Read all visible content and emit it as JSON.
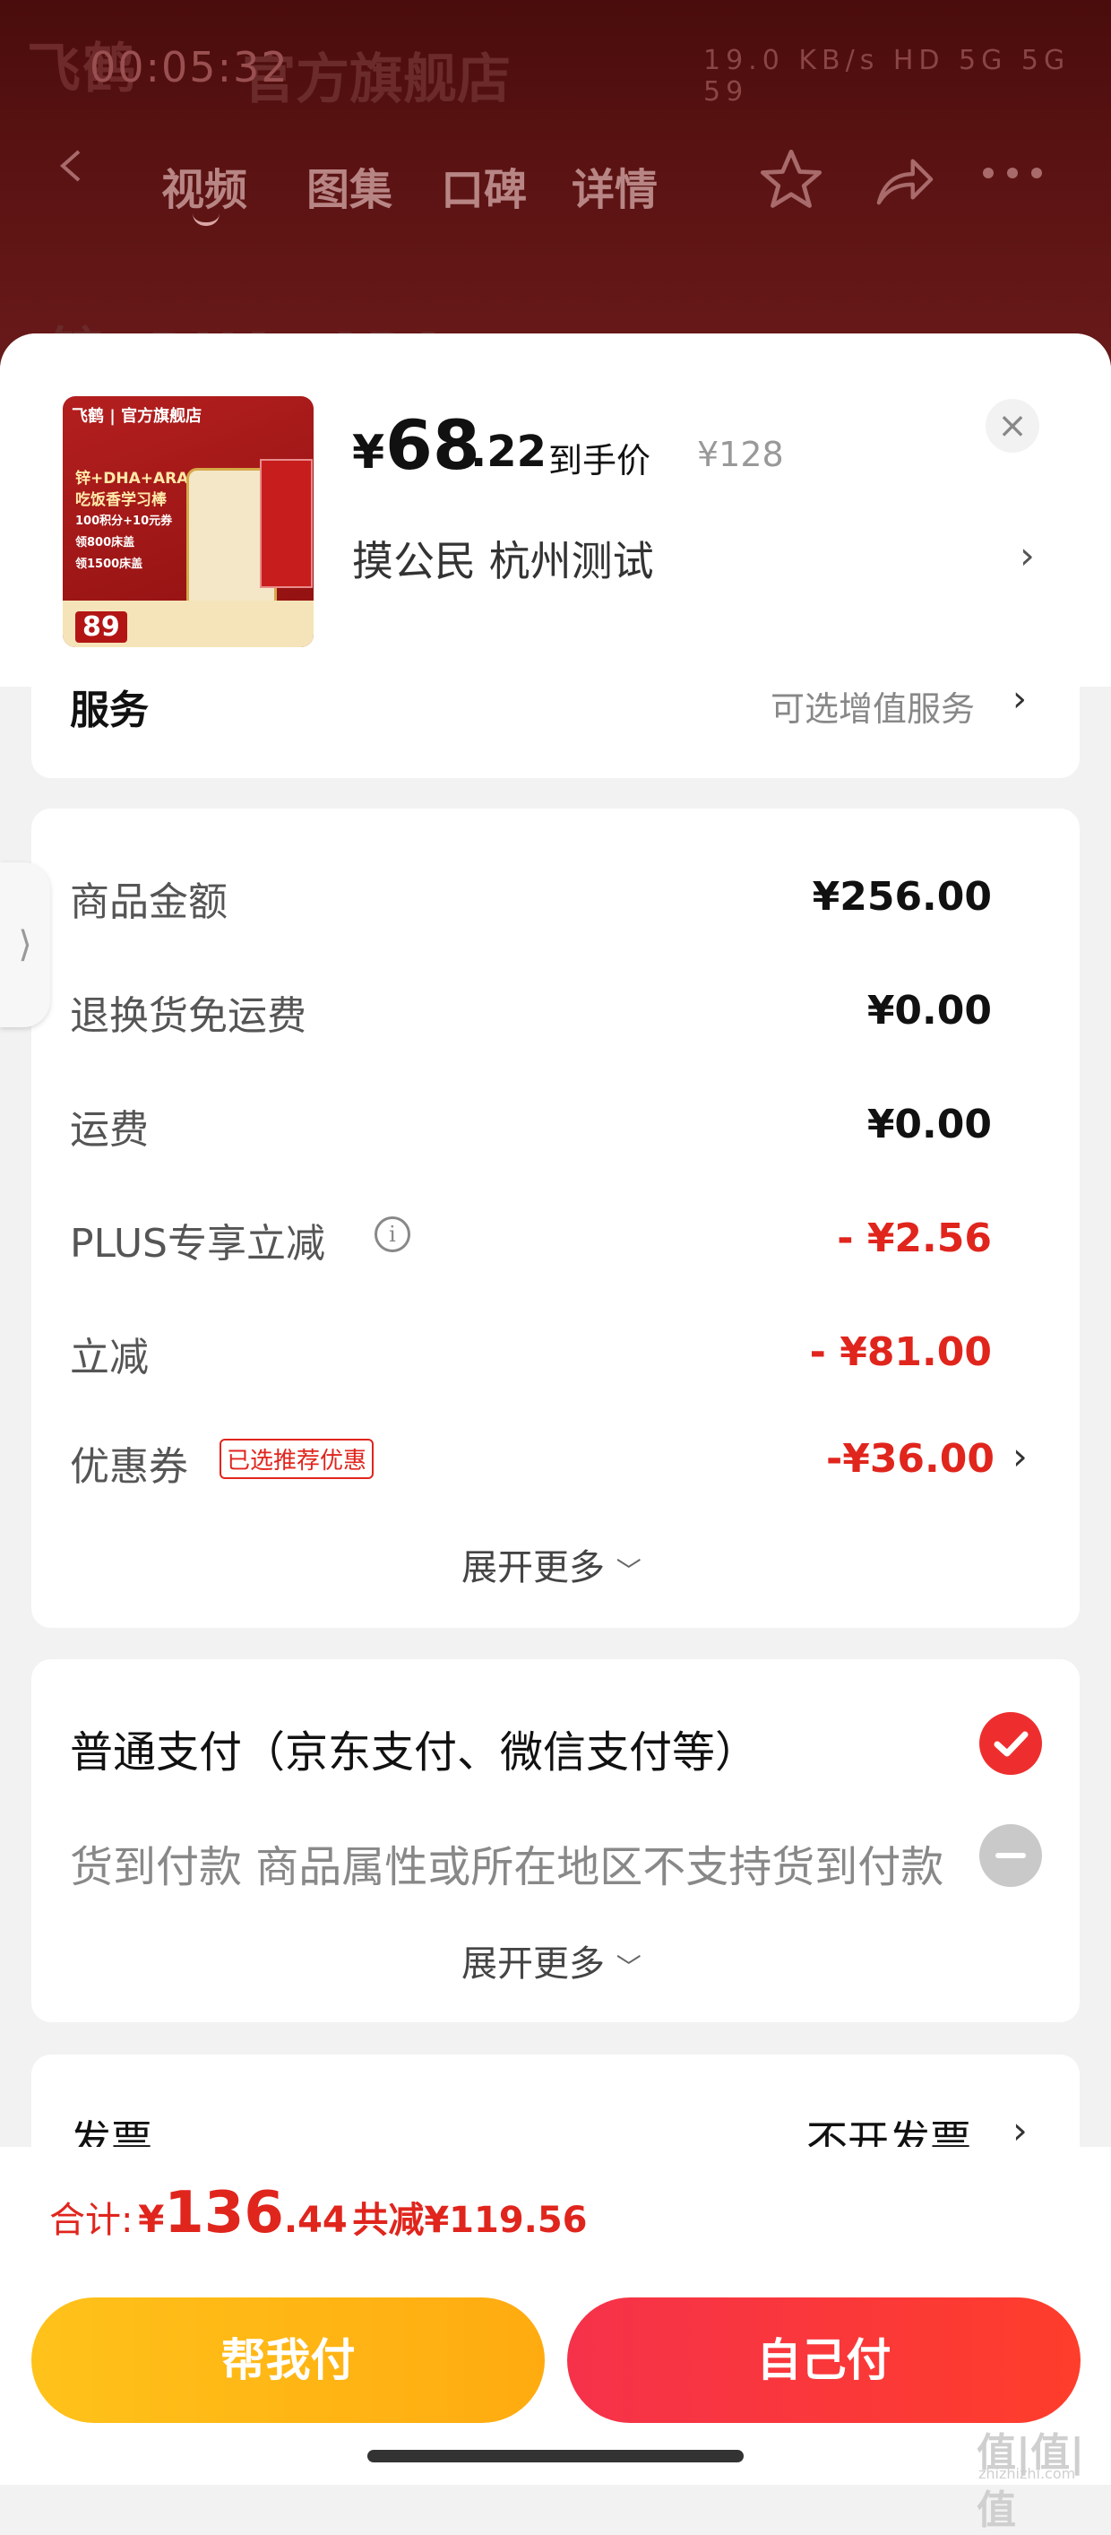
{
  "colors": {
    "accent": "#e0251d",
    "help_btn": "#ffb412",
    "self_btn": "#f5324a"
  },
  "background": {
    "logo": "飞鹤",
    "store": "官方旗舰店",
    "time": "00:05:32",
    "status": "19.0 KB/s  HD  5G  5G  59",
    "nav": [
      "视频",
      "图集",
      "口碑",
      "详情"
    ],
    "headline": "锌+DHA+ARA"
  },
  "product": {
    "thumb_brand": "飞鹤 | 官方旗舰店",
    "thumb_text": [
      "锌+DHA+ARA",
      "吃饭香学习棒",
      "100积分+10元券",
      "领800床盖",
      "领1500床盖"
    ],
    "thumb_price": "89",
    "currency": "¥",
    "price_int": "68",
    "price_dec": ".22",
    "price_label": "到手价",
    "original_price": "¥128",
    "address": "摸公民  杭州测试",
    "close": "×"
  },
  "service": {
    "label": "服务",
    "value": "可选增值服务"
  },
  "amounts": {
    "rows": [
      {
        "label": "商品金额",
        "value": "¥256.00"
      },
      {
        "label": "退换货免运费",
        "value": "¥0.00"
      },
      {
        "label": "运费",
        "value": "¥0.00"
      },
      {
        "label": "PLUS专享立减",
        "value": "- ¥2.56"
      },
      {
        "label": "立减",
        "value": "- ¥81.00"
      },
      {
        "label": "优惠券",
        "value": "-¥36.00"
      }
    ],
    "coupon_tag": "已选推荐优惠",
    "expand": "展开更多"
  },
  "payment": {
    "option1": "普通支付（京东支付、微信支付等）",
    "option2": "货到付款 商品属性或所在地区不支持货到付款",
    "expand": "展开更多"
  },
  "invoice": {
    "label": "发票",
    "value": "不开发票"
  },
  "total": {
    "label": "合计:",
    "currency": "¥",
    "int": "136",
    "dec": ".44",
    "saved": "共减¥119.56"
  },
  "buttons": {
    "help": "帮我付",
    "self": "自己付"
  },
  "watermark": {
    "main": "值|值|值",
    "sub": "zhizhizhi.com"
  }
}
